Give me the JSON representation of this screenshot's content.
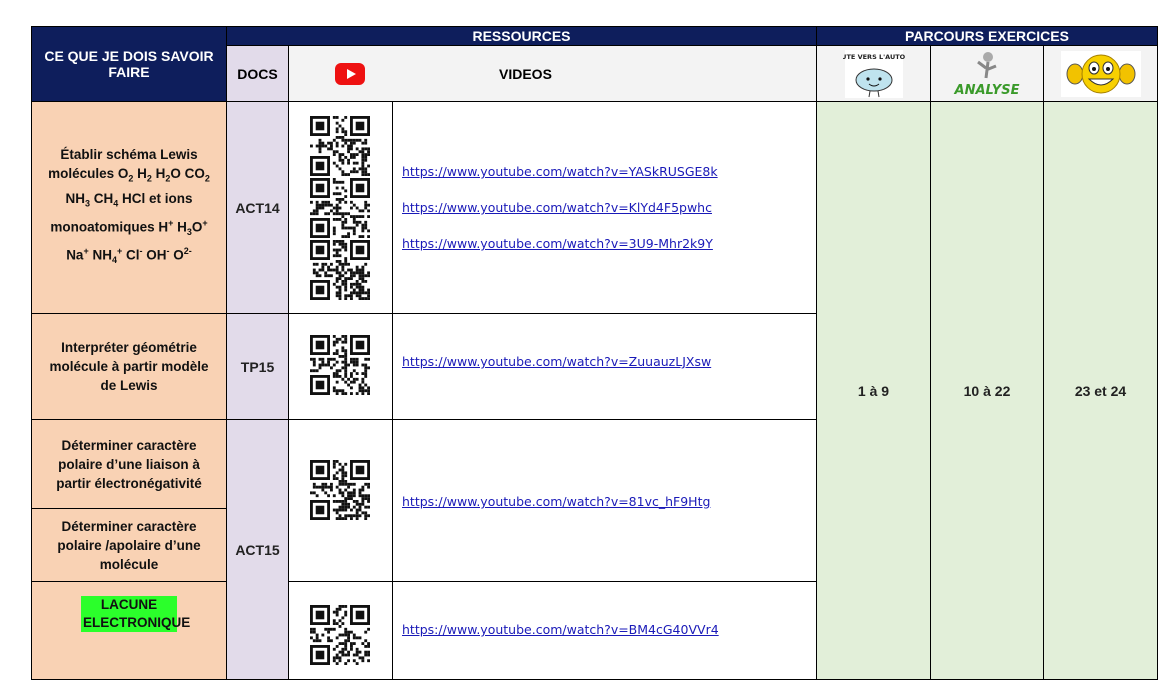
{
  "header": {
    "skills": "CE QUE JE DOIS SAVOIR FAIRE",
    "resources": "RESSOURCES",
    "parcours": "PARCOURS EXERCICES",
    "docs": "DOCS",
    "videos": "VIDEOS",
    "badge_autonomie": "EN ROUTE VERS L'AUTONOMIE",
    "badge_analyse": "ANALYSE"
  },
  "rows": [
    {
      "skill_parts": [
        "Établir schéma Lewis molécules O",
        "2",
        " H",
        "2",
        " H",
        "2",
        "O CO",
        "2",
        " NH",
        "3",
        " CH",
        "4",
        " HCl et ions monoatomiques H",
        "+",
        " H",
        "3",
        "O",
        "+",
        " Na",
        "+",
        " NH",
        "4",
        "+",
        " Cl",
        "-",
        " OH",
        "-",
        " O",
        "2-"
      ],
      "doc": "ACT14",
      "links": [
        "https://www.youtube.com/watch?v=YASkRUSGE8k",
        "https://www.youtube.com/watch?v=KlYd4F5pwhc",
        "https://www.youtube.com/watch?v=3U9-Mhr2k9Y"
      ]
    },
    {
      "skill": "Interpréter géométrie molécule à partir modèle de Lewis",
      "doc": "TP15",
      "links": [
        "https://www.youtube.com/watch?v=ZuuauzLJXsw"
      ]
    },
    {
      "skill": "Déterminer caractère polaire d’une liaison à partir électronégativité",
      "doc": "ACT15",
      "links": [
        "https://www.youtube.com/watch?v=81vc_hF9Htg"
      ]
    },
    {
      "skill": "Déterminer caractère polaire /apolaire d’une molécule"
    },
    {
      "skill": "LACUNE ELECTRONIQUE",
      "links": [
        "https://www.youtube.com/watch?v=BM4cG40VVr4"
      ]
    }
  ],
  "exercises": {
    "autonomie": "1 à 9",
    "analyse": "10 à 22",
    "defi": "23 et 24"
  },
  "colors": {
    "navy": "#0e1e5c",
    "lavender": "#e2dbea",
    "peach": "#f9d2b4",
    "green": "#e2efd9",
    "highlight": "#2bff2b",
    "link": "#1a1ab8"
  },
  "icons": [
    "youtube-icon",
    "qr-code-icon",
    "brain-cloud-icon",
    "analyse-figure-icon",
    "muscle-smiley-icon"
  ]
}
